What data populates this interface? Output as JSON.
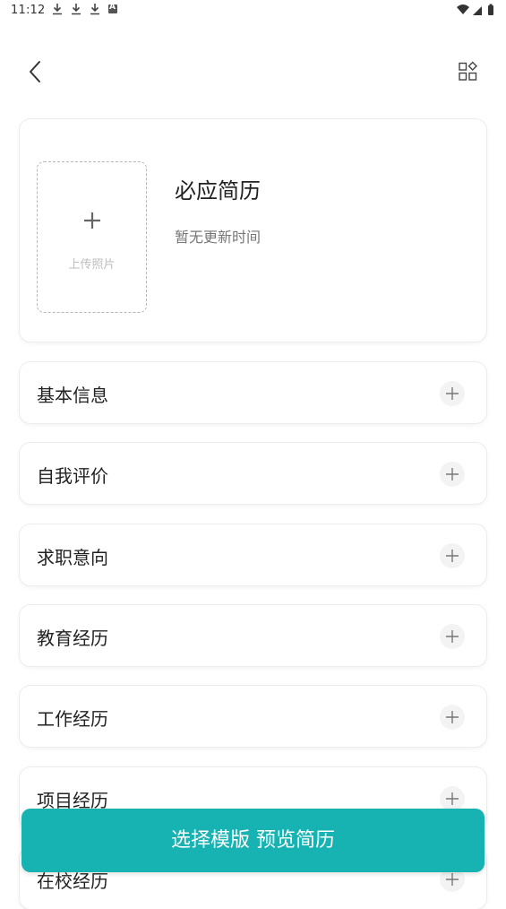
{
  "status_bar": {
    "time": "11:12"
  },
  "profile": {
    "photo_label": "上传照片",
    "title": "必应简历",
    "update_text": "暂无更新时间"
  },
  "sections": [
    {
      "label": "基本信息"
    },
    {
      "label": "自我评价"
    },
    {
      "label": "求职意向"
    },
    {
      "label": "教育经历"
    },
    {
      "label": "工作经历"
    },
    {
      "label": "项目经历"
    },
    {
      "label": "在校经历"
    }
  ],
  "footer": {
    "action_label": "选择模版  预览简历"
  },
  "colors": {
    "accent": "#17b3b3",
    "card_border": "#ececec",
    "muted_text": "#777777"
  },
  "icons": {
    "back": "chevron-left-icon",
    "apps": "grid-apps-icon",
    "add": "plus-icon",
    "download": "download-icon",
    "wifi": "wifi-icon",
    "signal": "signal-icon",
    "battery": "battery-icon"
  }
}
